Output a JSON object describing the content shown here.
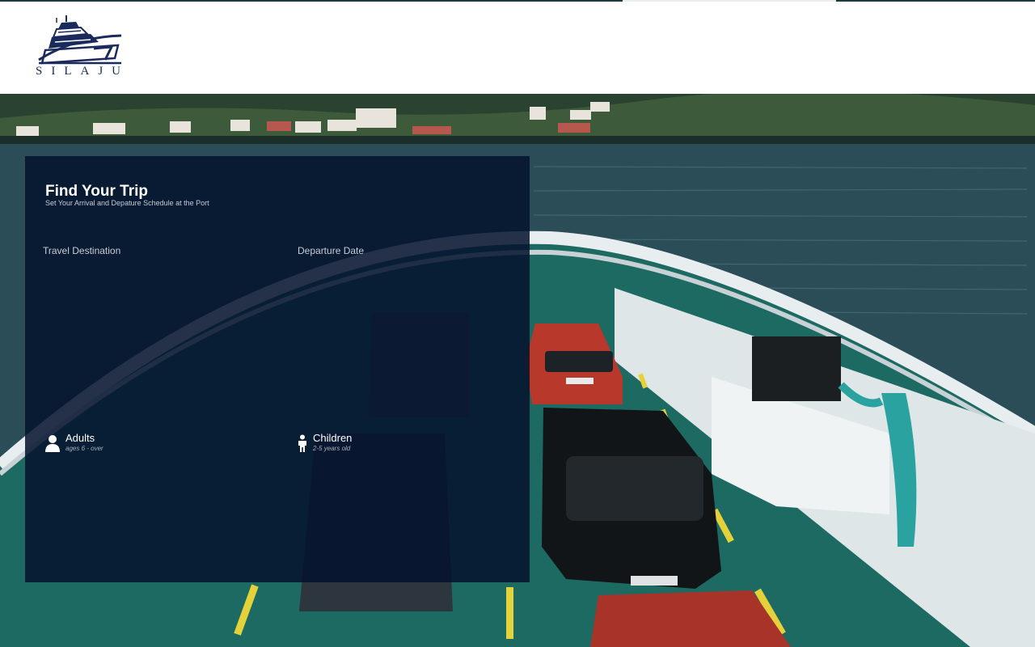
{
  "brand": {
    "name": "SILAJU",
    "logo_icon": "ship-logo-icon"
  },
  "search": {
    "title": "Find Your Trip",
    "subtitle": "Set Your Arrival and Depature Schedule at the Port",
    "destination_label": "Travel Destination",
    "date_label": "Departure Date"
  },
  "passengers": {
    "adults": {
      "label": "Adults",
      "hint": "ages 6 - over",
      "icon": "person-icon"
    },
    "children": {
      "label": "Children",
      "hint": "2-5 years old",
      "icon": "child-icon"
    }
  },
  "colors": {
    "brand_navy": "#1a2a5a",
    "panel_bg": "#03122d",
    "header_bg": "#ffffff"
  }
}
